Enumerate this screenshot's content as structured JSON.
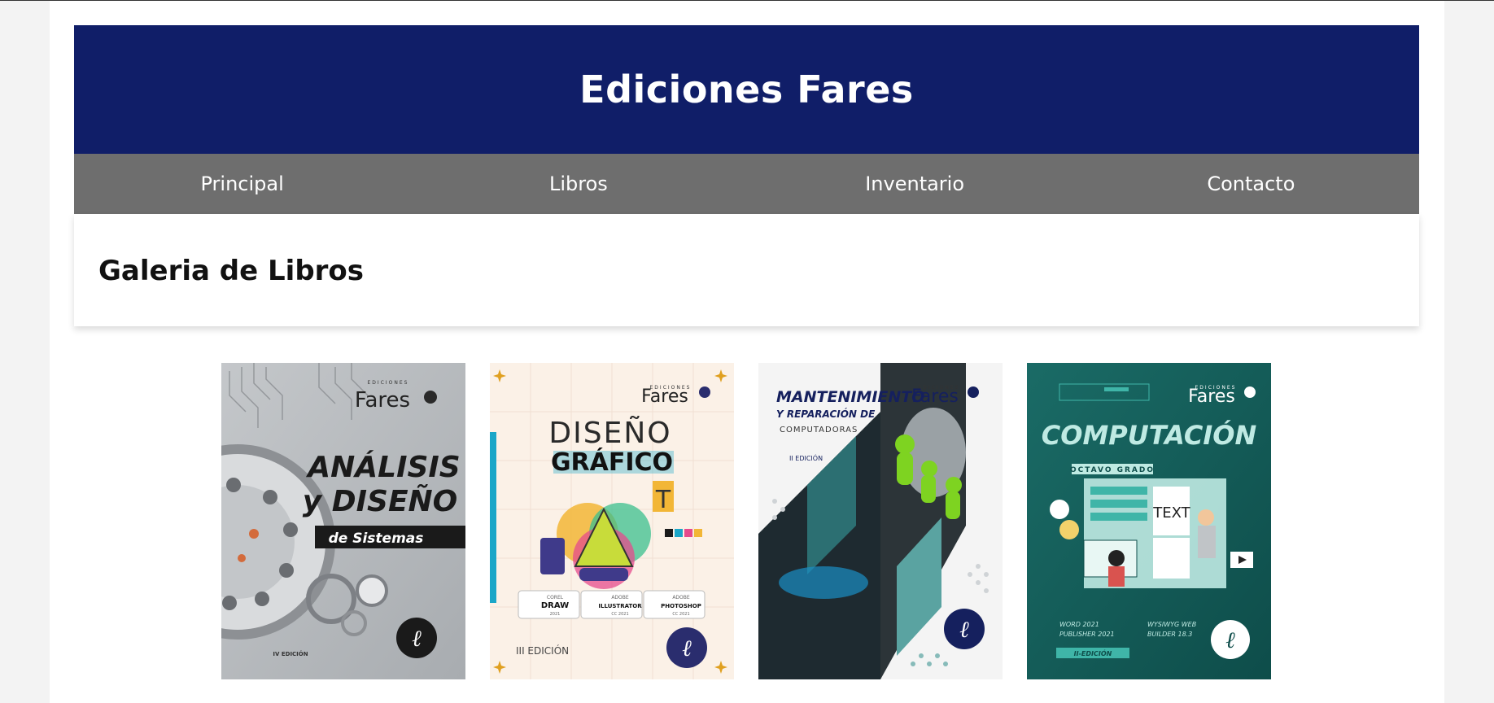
{
  "site": {
    "title": "Ediciones Fares"
  },
  "nav": {
    "items": [
      {
        "label": "Principal"
      },
      {
        "label": "Libros"
      },
      {
        "label": "Inventario"
      },
      {
        "label": "Contacto"
      }
    ]
  },
  "gallery": {
    "heading": "Galeria de Libros",
    "books": [
      {
        "publisher_top": "EDICIONES",
        "publisher": "Fares",
        "title_line1": "ANÁLISIS",
        "title_line2": "y DISEÑO",
        "subtitle": "de Sistemas",
        "edition": "IV EDICIÓN"
      },
      {
        "publisher_top": "EDICIONES",
        "publisher": "Fares",
        "title_line1": "DISEÑO",
        "title_line2": "GRÁFICO",
        "badges": [
          "DRAW",
          "ILLUSTRATOR",
          "PHOTOSHOP"
        ],
        "badge_small": [
          "COREL",
          "ADOBE",
          "ADOBE"
        ],
        "badge_version": [
          "2021",
          "CC 2021",
          "CC 2021"
        ],
        "edition": "III EDICIÓN"
      },
      {
        "publisher_top": "EDICIONES",
        "publisher": "Fares",
        "title_line1": "MANTENIMIENTO",
        "title_line2": "Y REPARACIÓN DE",
        "title_line3": "COMPUTADORAS",
        "edition": "II EDICIÓN"
      },
      {
        "publisher_top": "EDICIONES",
        "publisher": "Fares",
        "title_line1": "COMPUTACIÓN",
        "grade": "OCTAVO GRADO",
        "screen_text": "TEXT",
        "software_1": "WORD 2021",
        "software_2": "PUBLISHER 2021",
        "software_3": "WYSIWYG WEB",
        "software_4": "BUILDER 18.3",
        "edition": "II-EDICIÓN"
      }
    ]
  },
  "colors": {
    "header_bg": "#101e68",
    "nav_bg": "#6e6e6e",
    "page_bg": "#f3f3f3"
  }
}
